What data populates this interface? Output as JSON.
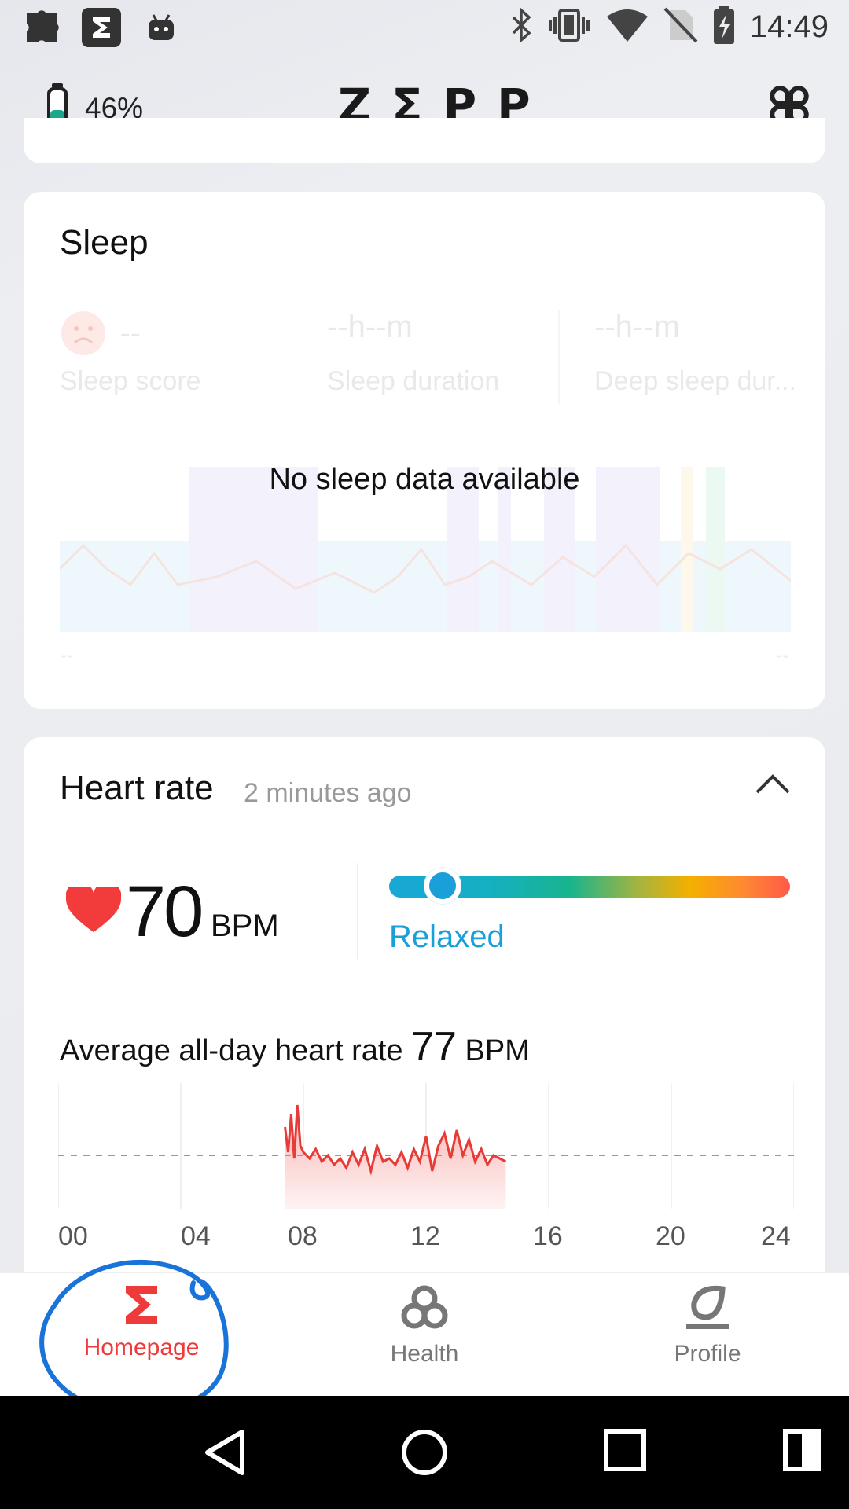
{
  "status_bar": {
    "time": "14:49",
    "left_icons": [
      "puzzle-icon",
      "zepp-app-icon",
      "android-icon"
    ],
    "right_icons": [
      "bluetooth-icon",
      "vibrate-icon",
      "wifi-icon",
      "no-sim-icon",
      "battery-charging-icon"
    ]
  },
  "header": {
    "battery_percent": "46%",
    "battery_level": 0.46,
    "logo": "ZΣPP"
  },
  "sleep": {
    "title": "Sleep",
    "score_value": "--",
    "score_label": "Sleep score",
    "duration_value": "--h--m",
    "duration_label": "Sleep duration",
    "deep_value": "--h--m",
    "deep_label": "Deep sleep dur...",
    "no_data": "No sleep data available",
    "foot_left": "--",
    "foot_right": "--"
  },
  "heart_rate": {
    "title": "Heart rate",
    "updated": "2 minutes ago",
    "value": "70",
    "unit": "BPM",
    "zone": "Relaxed",
    "avg_label": "Average all-day heart rate",
    "avg_value": "77",
    "avg_unit": "BPM",
    "ticks": [
      "00",
      "04",
      "08",
      "12",
      "16",
      "20",
      "24"
    ]
  },
  "chart_data": {
    "type": "area",
    "title": "",
    "xlabel": "",
    "ylabel": "",
    "x_ticks": [
      "00",
      "04",
      "08",
      "12",
      "16",
      "20",
      "24"
    ],
    "reference_line": 77,
    "series": [
      {
        "x": [
          7.4,
          7.5,
          7.6,
          7.7,
          7.8,
          7.9,
          8.0,
          8.2,
          8.4,
          8.6,
          8.8,
          9.0,
          9.2,
          9.4,
          9.6,
          9.8,
          10.0,
          10.2,
          10.4,
          10.6,
          10.8,
          11.0,
          11.2,
          11.4,
          11.6,
          11.8,
          12.0,
          12.2,
          12.4,
          12.6,
          12.8,
          13.0,
          13.2,
          13.4,
          13.6,
          13.8,
          14.0,
          14.2,
          14.4,
          14.6
        ],
        "values": [
          86,
          78,
          90,
          76,
          93,
          80,
          78,
          76,
          79,
          75,
          77,
          74,
          76,
          73,
          78,
          74,
          79,
          72,
          80,
          75,
          76,
          74,
          78,
          73,
          79,
          75,
          83,
          72,
          80,
          84,
          76,
          85,
          77,
          82,
          75,
          79,
          74,
          77,
          76,
          75
        ]
      }
    ]
  },
  "bottom_nav": {
    "items": [
      {
        "label": "Homepage",
        "icon": "sigma-icon"
      },
      {
        "label": "Health",
        "icon": "health-knot-icon"
      },
      {
        "label": "Profile",
        "icon": "profile-icon"
      }
    ]
  },
  "colors": {
    "accent_red": "#ee3a3a",
    "relaxed_blue": "#1aa0d8",
    "annotation_blue": "#1a73d9"
  }
}
